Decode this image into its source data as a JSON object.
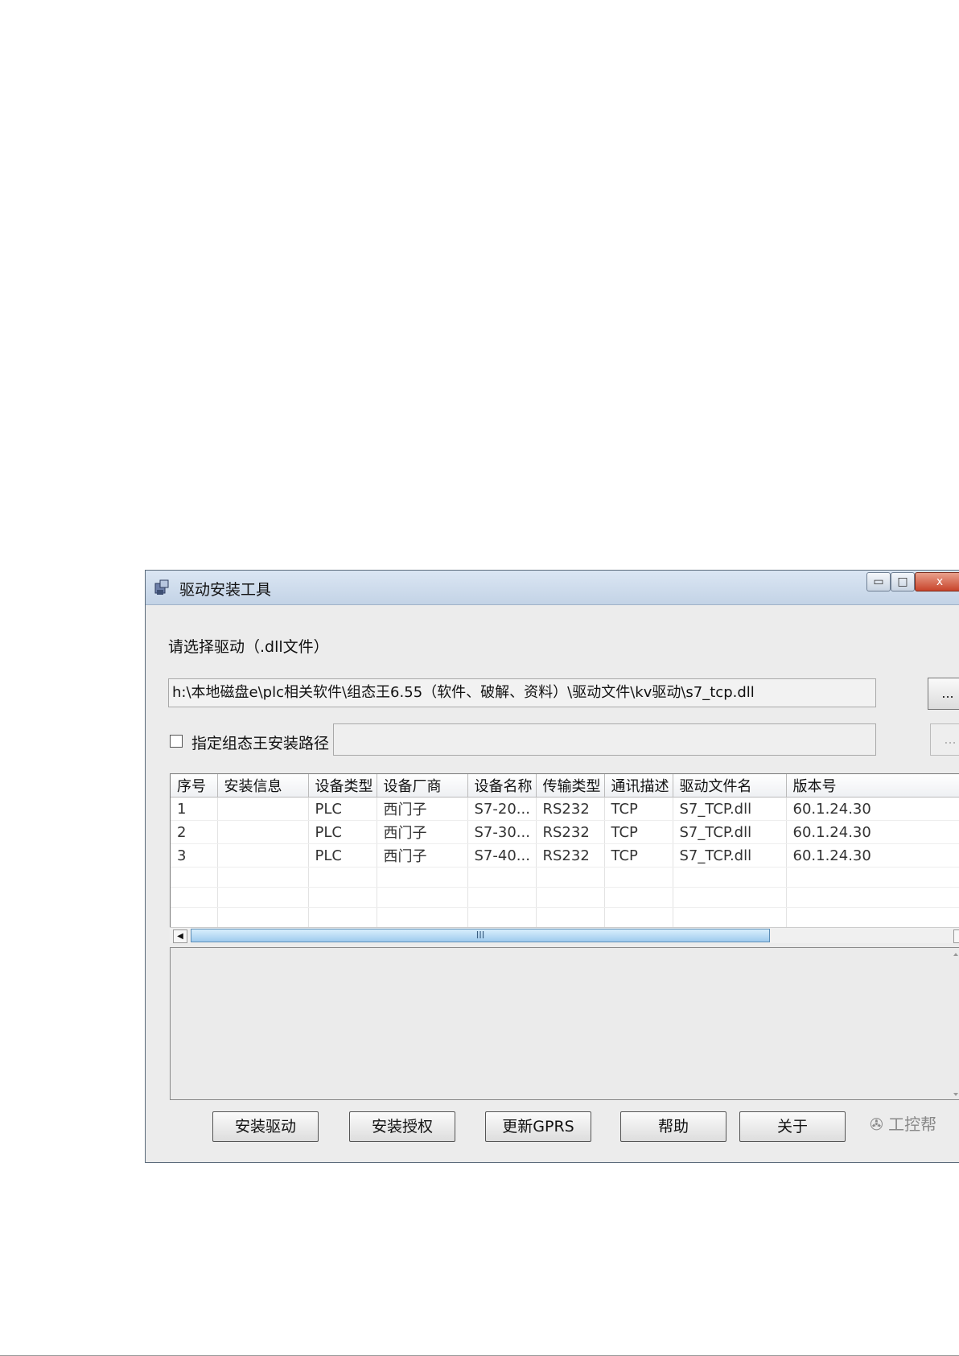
{
  "window": {
    "title": "驱动安装工具",
    "min_label": "▭",
    "max_label": "□",
    "close_label": "x"
  },
  "form": {
    "select_label": "请选择驱动（.dll文件）",
    "path_value": "h:\\本地磁盘e\\plc相关软件\\组态王6.55（软件、破解、资料）\\驱动文件\\kv驱动\\s7_tcp.dll",
    "browse_label": "...",
    "install_path_checkbox_label": "指定组态王安装路径",
    "install_path_value": "",
    "browse2_label": "..."
  },
  "table": {
    "columns": [
      "序号",
      "安装信息",
      "设备类型",
      "设备厂商",
      "设备名称",
      "传输类型",
      "通讯描述",
      "驱动文件名",
      "版本号"
    ],
    "rows": [
      [
        "1",
        "",
        "PLC",
        "西门子",
        "S7-20...",
        "RS232",
        "TCP",
        "S7_TCP.dll",
        "60.1.24.30"
      ],
      [
        "2",
        "",
        "PLC",
        "西门子",
        "S7-30...",
        "RS232",
        "TCP",
        "S7_TCP.dll",
        "60.1.24.30"
      ],
      [
        "3",
        "",
        "PLC",
        "西门子",
        "S7-40...",
        "RS232",
        "TCP",
        "S7_TCP.dll",
        "60.1.24.30"
      ]
    ],
    "empty_rows": 4
  },
  "scrollbar": {
    "thumb_grip": "III"
  },
  "buttons": {
    "install_driver": "安装驱动",
    "install_license": "安装授权",
    "update_gprs": "更新GPRS",
    "help": "帮助",
    "about": "关于"
  },
  "watermark": "工控帮"
}
